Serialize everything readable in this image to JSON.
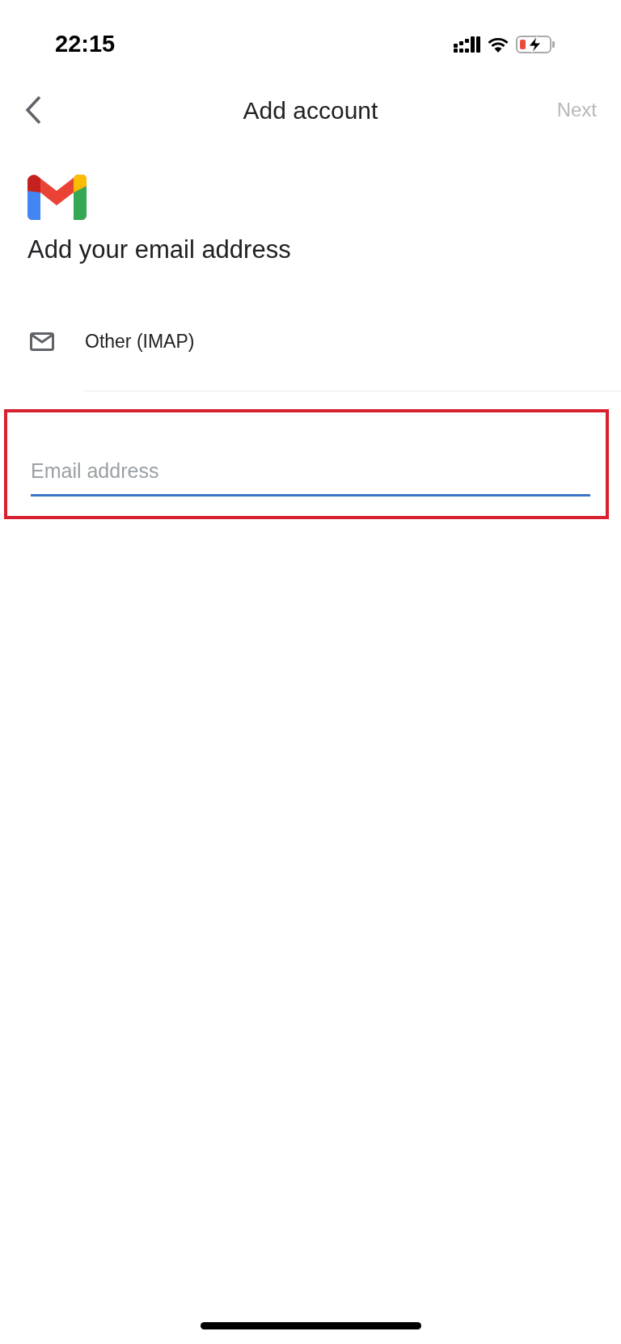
{
  "status_bar": {
    "time": "22:15",
    "battery_low": true,
    "charging": true
  },
  "header": {
    "title": "Add account",
    "next": {
      "label": "Next",
      "disabled": true
    }
  },
  "heading": "Add your email address",
  "provider": {
    "label": "Other (IMAP)"
  },
  "email_field": {
    "placeholder": "Email address",
    "focused": true,
    "highlighted": true
  }
}
